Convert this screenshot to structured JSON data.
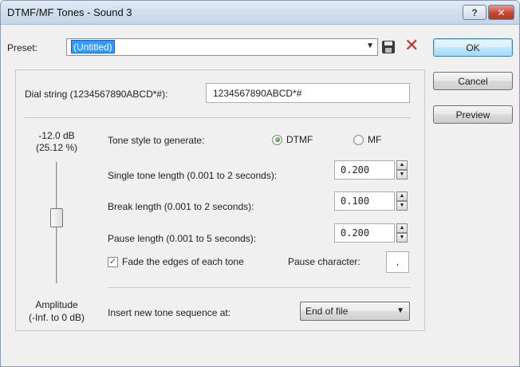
{
  "window": {
    "title": "DTMF/MF Tones - Sound 3",
    "help_glyph": "?",
    "close_glyph": "✕"
  },
  "preset": {
    "label": "Preset:",
    "value": "(Untitled)",
    "dropdown_glyph": "▼",
    "delete_glyph": "✕"
  },
  "buttons": {
    "ok": "OK",
    "cancel": "Cancel",
    "preview": "Preview"
  },
  "dial": {
    "label": "Dial string (1234567890ABCD*#):",
    "value": "1234567890ABCD*#"
  },
  "amplitude": {
    "db": "-12.0 dB",
    "percent": "(25.12 %)",
    "label": "Amplitude",
    "range": "(-Inf. to 0 dB)",
    "level_fraction": 0.55
  },
  "tone_style": {
    "label": "Tone style to generate:",
    "options": [
      {
        "label": "DTMF",
        "selected": true
      },
      {
        "label": "MF",
        "selected": false
      }
    ]
  },
  "params": [
    {
      "label": "Single tone length (0.001 to 2 seconds):",
      "value": "0.200"
    },
    {
      "label": "Break length (0.001 to 2 seconds):",
      "value": "0.100"
    },
    {
      "label": "Pause length (0.001 to 5 seconds):",
      "value": "0.200"
    }
  ],
  "spin_glyphs": {
    "up": "▲",
    "down": "▼"
  },
  "fade": {
    "label": "Fade the edges of each tone",
    "checked": true,
    "check_glyph": "✓"
  },
  "pause_char": {
    "label": "Pause character:",
    "value": ","
  },
  "insert": {
    "label": "Insert new tone sequence at:",
    "value": "End of file",
    "dropdown_glyph": "▼"
  },
  "colors": {
    "accent_selection": "#3399ff",
    "delete_red": "#c8312b",
    "close_button_red": "#c8452f"
  }
}
